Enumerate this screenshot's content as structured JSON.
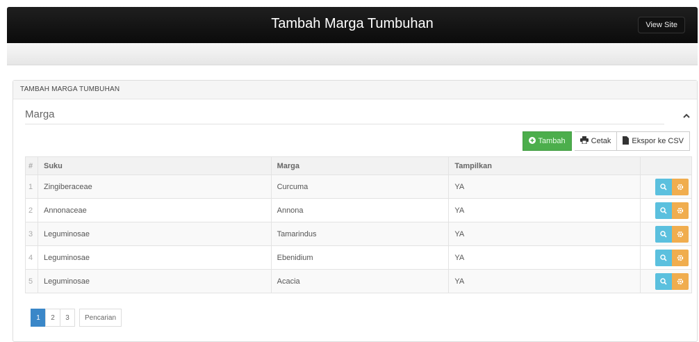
{
  "header": {
    "title": "Tambah Marga Tumbuhan",
    "view_site": "View Site"
  },
  "panel": {
    "heading": "TAMBAH MARGA TUMBUHAN",
    "legend": "Marga"
  },
  "toolbar": {
    "add_label": "Tambah",
    "print_label": "Cetak",
    "export_label": "Ekspor ke CSV"
  },
  "table": {
    "columns": [
      "#",
      "Suku",
      "Marga",
      "Tampilkan"
    ],
    "rows": [
      {
        "no": "1",
        "suku": "Zingiberaceae",
        "marga": "Curcuma",
        "tampilkan": "YA"
      },
      {
        "no": "2",
        "suku": "Annonaceae",
        "marga": "Annona",
        "tampilkan": "YA"
      },
      {
        "no": "3",
        "suku": "Leguminosae",
        "marga": "Tamarindus",
        "tampilkan": "YA"
      },
      {
        "no": "4",
        "suku": "Leguminosae",
        "marga": "Ebenidium",
        "tampilkan": "YA"
      },
      {
        "no": "5",
        "suku": "Leguminosae",
        "marga": "Acacia",
        "tampilkan": "YA"
      }
    ]
  },
  "pagination": {
    "pages": [
      "1",
      "2",
      "3"
    ],
    "search_label": "Pencarian",
    "current": "1"
  },
  "colors": {
    "success": "#4cae4c",
    "info": "#5bc0de",
    "warning": "#f0ad4e",
    "primary": "#3a87c8"
  },
  "icons": {
    "add": "plus-circle-icon",
    "print": "print-icon",
    "export": "file-icon",
    "view": "search-icon",
    "edit": "gear-icon",
    "collapse": "chevron-up-icon"
  }
}
